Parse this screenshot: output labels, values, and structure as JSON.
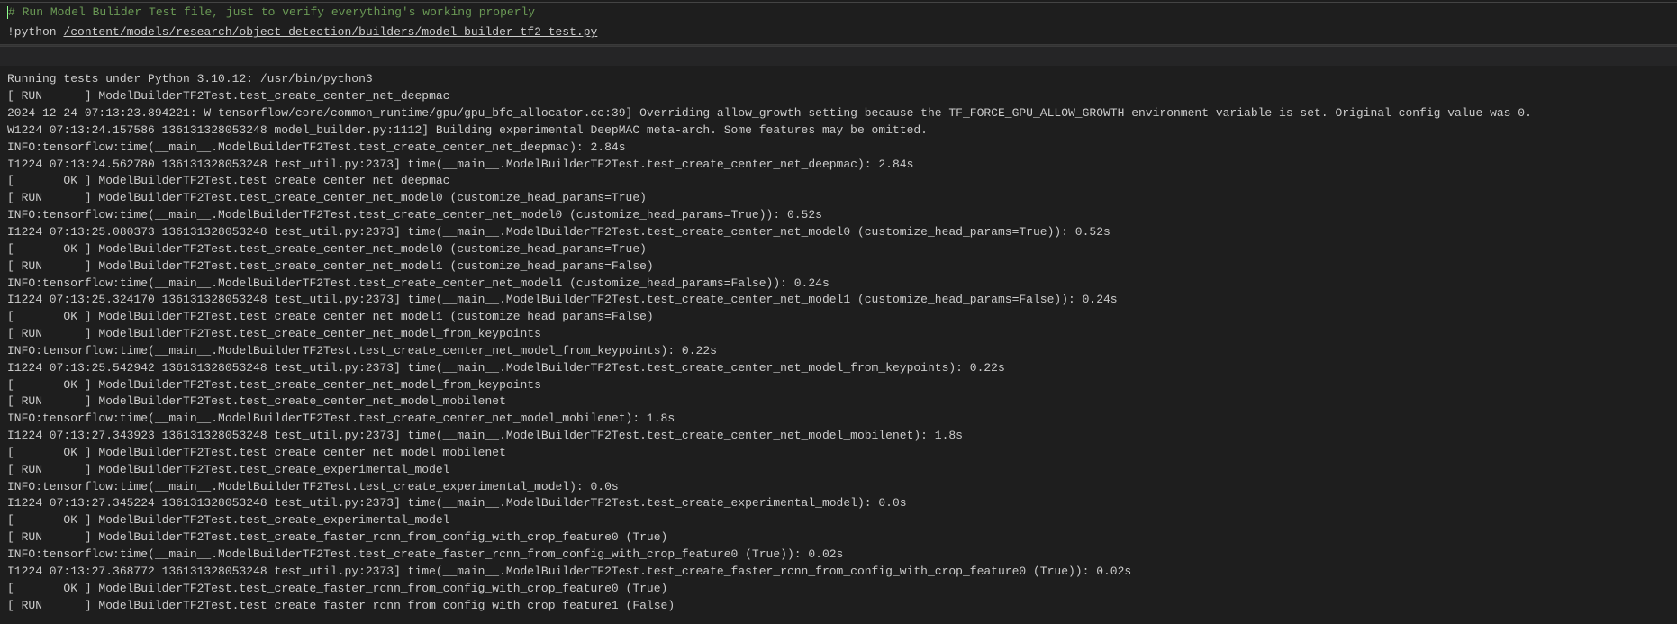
{
  "code": {
    "comment_prefix": "#",
    "comment_text": " Run Model Bulider Test file, just to verify everything's working properly",
    "bang": "!python ",
    "path": "/content/models/research/object_detection/builders/model_builder_tf2_test.py"
  },
  "output_lines": [
    "Running tests under Python 3.10.12: /usr/bin/python3",
    "[ RUN      ] ModelBuilderTF2Test.test_create_center_net_deepmac",
    "2024-12-24 07:13:23.894221: W tensorflow/core/common_runtime/gpu/gpu_bfc_allocator.cc:39] Overriding allow_growth setting because the TF_FORCE_GPU_ALLOW_GROWTH environment variable is set. Original config value was 0.",
    "W1224 07:13:24.157586 136131328053248 model_builder.py:1112] Building experimental DeepMAC meta-arch. Some features may be omitted.",
    "INFO:tensorflow:time(__main__.ModelBuilderTF2Test.test_create_center_net_deepmac): 2.84s",
    "I1224 07:13:24.562780 136131328053248 test_util.py:2373] time(__main__.ModelBuilderTF2Test.test_create_center_net_deepmac): 2.84s",
    "[       OK ] ModelBuilderTF2Test.test_create_center_net_deepmac",
    "[ RUN      ] ModelBuilderTF2Test.test_create_center_net_model0 (customize_head_params=True)",
    "INFO:tensorflow:time(__main__.ModelBuilderTF2Test.test_create_center_net_model0 (customize_head_params=True)): 0.52s",
    "I1224 07:13:25.080373 136131328053248 test_util.py:2373] time(__main__.ModelBuilderTF2Test.test_create_center_net_model0 (customize_head_params=True)): 0.52s",
    "[       OK ] ModelBuilderTF2Test.test_create_center_net_model0 (customize_head_params=True)",
    "[ RUN      ] ModelBuilderTF2Test.test_create_center_net_model1 (customize_head_params=False)",
    "INFO:tensorflow:time(__main__.ModelBuilderTF2Test.test_create_center_net_model1 (customize_head_params=False)): 0.24s",
    "I1224 07:13:25.324170 136131328053248 test_util.py:2373] time(__main__.ModelBuilderTF2Test.test_create_center_net_model1 (customize_head_params=False)): 0.24s",
    "[       OK ] ModelBuilderTF2Test.test_create_center_net_model1 (customize_head_params=False)",
    "[ RUN      ] ModelBuilderTF2Test.test_create_center_net_model_from_keypoints",
    "INFO:tensorflow:time(__main__.ModelBuilderTF2Test.test_create_center_net_model_from_keypoints): 0.22s",
    "I1224 07:13:25.542942 136131328053248 test_util.py:2373] time(__main__.ModelBuilderTF2Test.test_create_center_net_model_from_keypoints): 0.22s",
    "[       OK ] ModelBuilderTF2Test.test_create_center_net_model_from_keypoints",
    "[ RUN      ] ModelBuilderTF2Test.test_create_center_net_model_mobilenet",
    "INFO:tensorflow:time(__main__.ModelBuilderTF2Test.test_create_center_net_model_mobilenet): 1.8s",
    "I1224 07:13:27.343923 136131328053248 test_util.py:2373] time(__main__.ModelBuilderTF2Test.test_create_center_net_model_mobilenet): 1.8s",
    "[       OK ] ModelBuilderTF2Test.test_create_center_net_model_mobilenet",
    "[ RUN      ] ModelBuilderTF2Test.test_create_experimental_model",
    "INFO:tensorflow:time(__main__.ModelBuilderTF2Test.test_create_experimental_model): 0.0s",
    "I1224 07:13:27.345224 136131328053248 test_util.py:2373] time(__main__.ModelBuilderTF2Test.test_create_experimental_model): 0.0s",
    "[       OK ] ModelBuilderTF2Test.test_create_experimental_model",
    "[ RUN      ] ModelBuilderTF2Test.test_create_faster_rcnn_from_config_with_crop_feature0 (True)",
    "INFO:tensorflow:time(__main__.ModelBuilderTF2Test.test_create_faster_rcnn_from_config_with_crop_feature0 (True)): 0.02s",
    "I1224 07:13:27.368772 136131328053248 test_util.py:2373] time(__main__.ModelBuilderTF2Test.test_create_faster_rcnn_from_config_with_crop_feature0 (True)): 0.02s",
    "[       OK ] ModelBuilderTF2Test.test_create_faster_rcnn_from_config_with_crop_feature0 (True)",
    "[ RUN      ] ModelBuilderTF2Test.test_create_faster_rcnn_from_config_with_crop_feature1 (False)"
  ]
}
